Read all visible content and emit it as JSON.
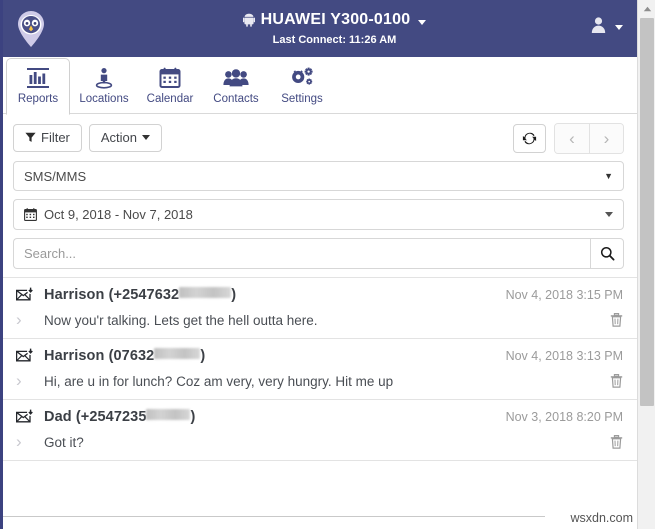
{
  "app": {
    "logo_icon": "owl-location-pin-logo",
    "accent_color": "#434a82",
    "background": "#ffffff"
  },
  "header": {
    "device_icon": "android-icon",
    "device_name": "HUAWEI Y300-0100",
    "device_caret_icon": "chevron-down-icon",
    "last_connect": "Last Connect: 11:26 AM",
    "user_icon": "user-avatar-icon",
    "user_caret_icon": "chevron-down-icon"
  },
  "tabs": [
    {
      "label": "Reports",
      "icon": "bar-chart-icon",
      "active": true
    },
    {
      "label": "Locations",
      "icon": "map-person-pin-icon",
      "active": false
    },
    {
      "label": "Calendar",
      "icon": "calendar-icon",
      "active": false
    },
    {
      "label": "Contacts",
      "icon": "people-group-icon",
      "active": false
    },
    {
      "label": "Settings",
      "icon": "gears-icon",
      "active": false
    }
  ],
  "toolbar": {
    "filter_label": "Filter",
    "filter_icon": "funnel-icon",
    "action_label": "Action",
    "action_caret_icon": "chevron-down-icon",
    "refresh_icon": "refresh-icon",
    "prev_icon": "chevron-left-icon",
    "next_icon": "chevron-right-icon"
  },
  "filters": {
    "report_type": {
      "value": "SMS/MMS",
      "caret_icon": "chevron-down-icon"
    },
    "date_range": {
      "value": "Oct 9, 2018 - Nov 7, 2018",
      "icon": "calendar-icon",
      "caret_icon": "chevron-down-icon"
    },
    "search": {
      "value": "",
      "placeholder": "Search...",
      "button_icon": "search-icon"
    }
  },
  "messages": [
    {
      "icon": "envelope-incoming-icon",
      "sender": "Harrison",
      "number_prefix": "+2547632",
      "number_redacted_width": 52,
      "date": "Nov 4, 2018 3:15 PM",
      "expand_icon": "chevron-right-icon",
      "text": "Now you'r talking. Lets get the hell outta here.",
      "delete_icon": "trash-icon"
    },
    {
      "icon": "envelope-incoming-icon",
      "sender": "Harrison",
      "number_prefix": "07632",
      "number_redacted_width": 46,
      "date": "Nov 4, 2018 3:13 PM",
      "expand_icon": "chevron-right-icon",
      "text": "Hi, are u in for lunch? Coz am very, very hungry. Hit me up",
      "delete_icon": "trash-icon"
    },
    {
      "icon": "envelope-incoming-icon",
      "sender": "Dad",
      "number_prefix": "+2547235",
      "number_redacted_width": 44,
      "date": "Nov 3, 2018 8:20 PM",
      "expand_icon": "chevron-right-icon",
      "text": "Got it?",
      "delete_icon": "trash-icon"
    }
  ],
  "scrollbar": {
    "up_icon": "scroll-up-arrow-icon"
  },
  "watermark": "wsxdn.com"
}
